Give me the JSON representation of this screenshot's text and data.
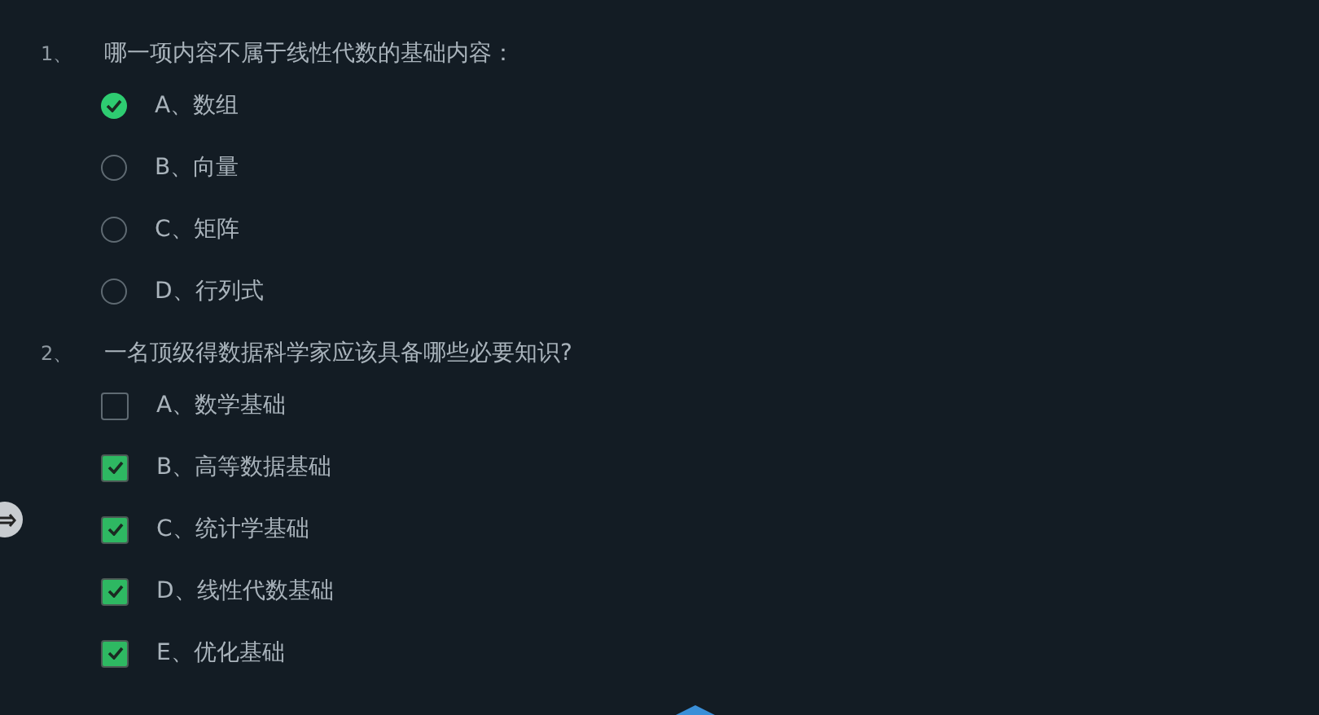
{
  "questions": [
    {
      "number": "1、",
      "text": "哪一项内容不属于线性代数的基础内容：",
      "options": [
        {
          "kind": "radio",
          "label": "A、数组",
          "selected": true
        },
        {
          "kind": "radio",
          "label": "B、向量",
          "selected": false
        },
        {
          "kind": "radio",
          "label": "C、矩阵",
          "selected": false
        },
        {
          "kind": "radio",
          "label": "D、行列式",
          "selected": false
        }
      ]
    },
    {
      "number": "2、",
      "text": "一名顶级得数据科学家应该具备哪些必要知识?",
      "options": [
        {
          "kind": "checkbox",
          "label": "A、数学基础",
          "checked": false
        },
        {
          "kind": "checkbox",
          "label": "B、高等数据基础",
          "checked": true
        },
        {
          "kind": "checkbox",
          "label": "C、统计学基础",
          "checked": true
        },
        {
          "kind": "checkbox",
          "label": "D、线性代数基础",
          "checked": true
        },
        {
          "kind": "checkbox",
          "label": "E、优化基础",
          "checked": true
        }
      ]
    }
  ]
}
